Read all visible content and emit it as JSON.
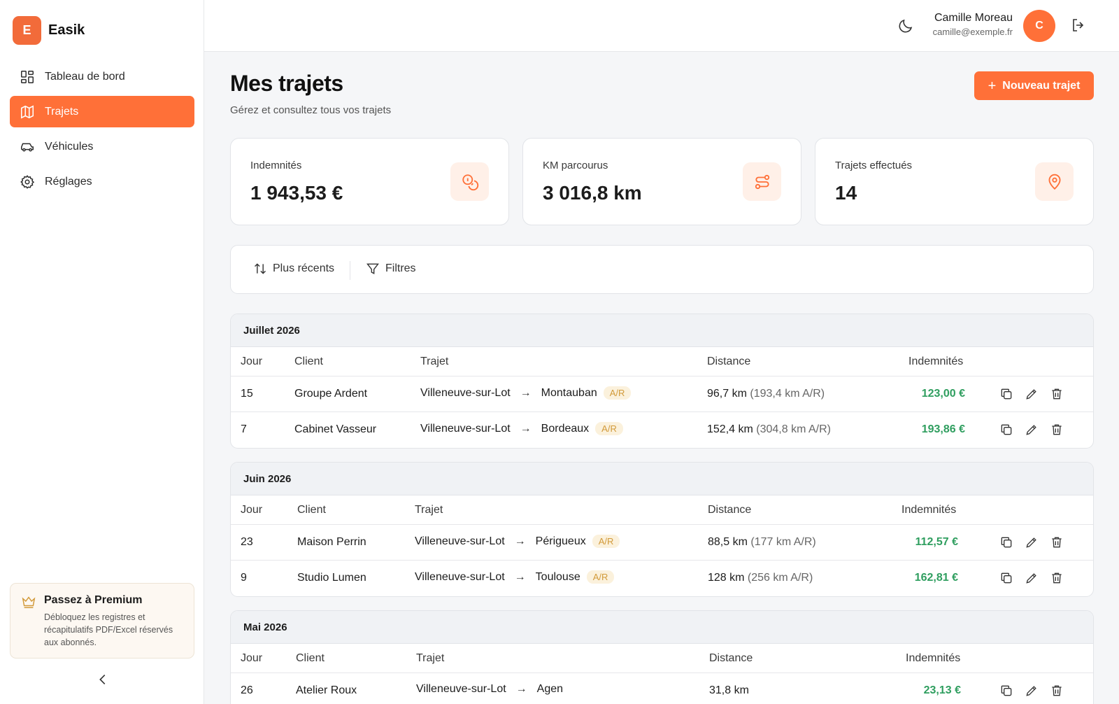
{
  "app": {
    "logo_letter": "E",
    "name": "Easik"
  },
  "sidebar": {
    "items": [
      {
        "label": "Tableau de bord",
        "icon": "dashboard-icon"
      },
      {
        "label": "Trajets",
        "icon": "map-icon",
        "active": true
      },
      {
        "label": "Véhicules",
        "icon": "car-icon"
      },
      {
        "label": "Réglages",
        "icon": "gear-icon"
      }
    ],
    "premium": {
      "title": "Passez à Premium",
      "text": "Débloquez les registres et récapitulatifs PDF/Excel réservés aux abonnés."
    }
  },
  "user": {
    "name": "Camille Moreau",
    "email": "camille@exemple.fr",
    "initial": "C"
  },
  "page": {
    "title": "Mes trajets",
    "subtitle": "Gérez et consultez tous vos trajets",
    "new_button": "Nouveau trajet"
  },
  "stats": [
    {
      "label": "Indemnités",
      "value": "1 943,53 €",
      "icon": "coins-icon"
    },
    {
      "label": "KM parcourus",
      "value": "3 016,8 km",
      "icon": "route-icon"
    },
    {
      "label": "Trajets effectués",
      "value": "14",
      "icon": "map-pin-icon"
    }
  ],
  "filters": {
    "sort_label": "Plus récents",
    "filter_label": "Filtres"
  },
  "table_headers": {
    "day": "Jour",
    "client": "Client",
    "route": "Trajet",
    "distance": "Distance",
    "allowance": "Indemnités"
  },
  "groups": [
    {
      "month": "Juillet 2026",
      "rows": [
        {
          "day": "15",
          "client": "Groupe Ardent",
          "from": "Villeneuve-sur-Lot",
          "to": "Montauban",
          "ar": "A/R",
          "distance": "96,7 km",
          "distance_ar": "(193,4 km A/R)",
          "amount": "123,00 €"
        },
        {
          "day": "7",
          "client": "Cabinet Vasseur",
          "from": "Villeneuve-sur-Lot",
          "to": "Bordeaux",
          "ar": "A/R",
          "distance": "152,4 km",
          "distance_ar": "(304,8 km A/R)",
          "amount": "193,86 €"
        }
      ]
    },
    {
      "month": "Juin 2026",
      "rows": [
        {
          "day": "23",
          "client": "Maison Perrin",
          "from": "Villeneuve-sur-Lot",
          "to": "Périgueux",
          "ar": "A/R",
          "distance": "88,5 km",
          "distance_ar": "(177 km A/R)",
          "amount": "112,57 €"
        },
        {
          "day": "9",
          "client": "Studio Lumen",
          "from": "Villeneuve-sur-Lot",
          "to": "Toulouse",
          "ar": "A/R",
          "distance": "128 km",
          "distance_ar": "(256 km A/R)",
          "amount": "162,81 €"
        }
      ]
    },
    {
      "month": "Mai 2026",
      "rows": [
        {
          "day": "26",
          "client": "Atelier Roux",
          "from": "Villeneuve-sur-Lot",
          "to": "Agen",
          "ar": "",
          "distance": "31,8 km",
          "distance_ar": "",
          "amount": "23,13 €"
        }
      ]
    }
  ],
  "colors": {
    "accent": "#ff7038",
    "amount": "#2f9e5f",
    "ar_badge": "#d29a3a"
  }
}
